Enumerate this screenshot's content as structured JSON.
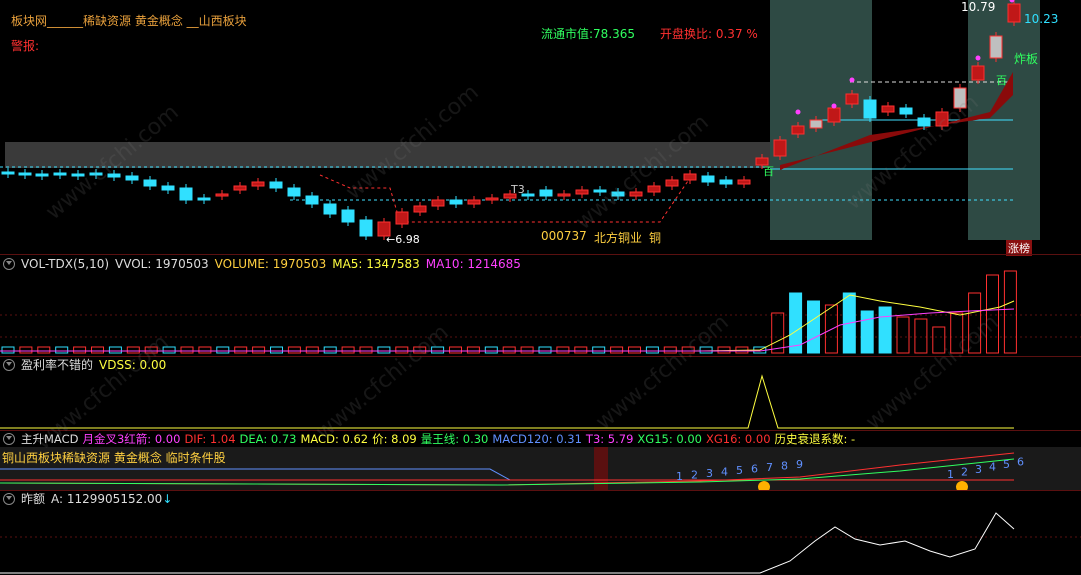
{
  "main": {
    "sector_line": "板块网______稀缺资源 黄金概念 __山西板块",
    "alert_label": "警报:",
    "circ_value": "流通市值:78.365",
    "turnover_ratio": "开盘换比: 0.37 %",
    "price_high": "10.79",
    "price_tick": "10.23",
    "low_label": "←6.98",
    "stock_code": "000737",
    "stock_name": "北方铜业",
    "stock_short": "铜",
    "t3_label": "T3",
    "bai_label_1": "百",
    "bai_label_2": "百",
    "zhaban_label": "炸板",
    "zhangting_label": "涨榜"
  },
  "vol_pane": {
    "title": "VOL-TDX(5,10)",
    "vvol": "VVOL: 1970503",
    "volume": "VOLUME: 1970503",
    "ma5": "MA5: 1347583",
    "ma10": "MA10: 1214685"
  },
  "vdss_pane": {
    "title": "盈利率不错的",
    "vdss": "VDSS: 0.00"
  },
  "macd_pane": {
    "title": "主升MACD",
    "jinjia": "月金叉3红箭: 0.00",
    "dif": "DIF: 1.04",
    "dea": "DEA: 0.73",
    "macd": "MACD: 0.62",
    "price": "价: 8.09",
    "wangxian": "量王线: 0.30",
    "macd120": "MACD120: 0.31",
    "t3": "T3: 5.79",
    "xg15": "XG15: 0.00",
    "xg16": "XG16: 0.00",
    "shuaitui": "历史衰退系数: -",
    "concept_line": "铜山西板块稀缺资源 黄金概念 临时条件股",
    "counts_1": [
      "1",
      "2",
      "3",
      "4",
      "5",
      "6",
      "7",
      "8",
      "9"
    ],
    "counts_2": [
      "1",
      "2",
      "3",
      "4",
      "5",
      "6"
    ]
  },
  "amount_pane": {
    "title": "昨额",
    "value": "A: 1129905152.00"
  },
  "watermark": "www.cfchi.com",
  "colors": {
    "up": "#ff3030",
    "down": "#30e0ff",
    "ma5": "#ffff40",
    "ma10": "#ff40ff",
    "highlight": "#2e4a44"
  }
}
